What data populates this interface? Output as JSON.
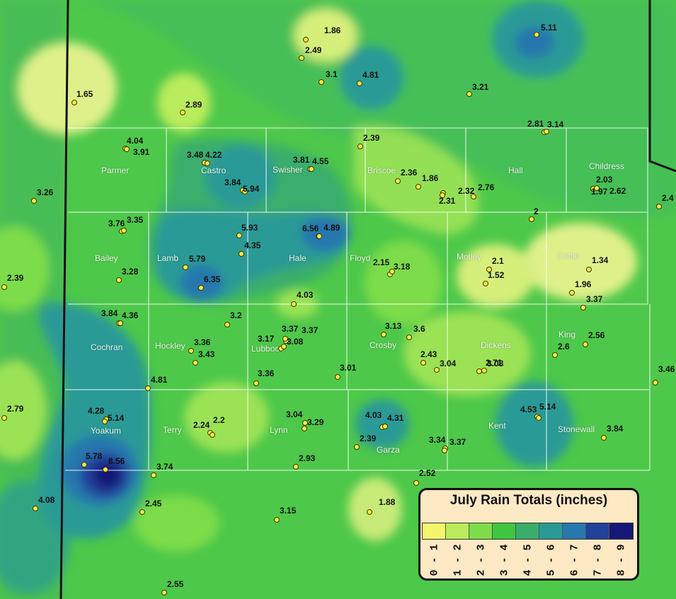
{
  "legend": {
    "title": "July Rain Totals (inches)",
    "bins": [
      {
        "label": "0 - 1",
        "color": "#f4f56c"
      },
      {
        "label": "1 - 2",
        "color": "#b9ec5c"
      },
      {
        "label": "2 - 3",
        "color": "#7ddc4a"
      },
      {
        "label": "3 - 4",
        "color": "#3fc63f"
      },
      {
        "label": "4 - 5",
        "color": "#3aad6c"
      },
      {
        "label": "5 - 6",
        "color": "#2a9a96"
      },
      {
        "label": "6 - 7",
        "color": "#2877ad"
      },
      {
        "label": "7 - 8",
        "color": "#22419a"
      },
      {
        "label": "8 - 9",
        "color": "#161877"
      }
    ]
  },
  "counties": [
    "Parmer",
    "Castro",
    "Swisher",
    "Briscoe",
    "Hall",
    "Childress",
    "Bailey",
    "Lamb",
    "Hale",
    "Floyd",
    "Motley",
    "Cottle",
    "Cochran",
    "Hockley",
    "Lubbock",
    "Crosby",
    "Dickens",
    "King",
    "Yoakum",
    "Terry",
    "Lynn",
    "Garza",
    "Kent",
    "Stonewall"
  ],
  "stations": [
    "1.86",
    "2.49",
    "5.11",
    "1.65",
    "3.1",
    "4.81",
    "3.21",
    "2.89",
    "2.81",
    "3.14",
    "4.04",
    "3.91",
    "2.39",
    "3.48",
    "4.22",
    "3.81",
    "4.55",
    "2.36",
    "1.86",
    "3.26",
    "3.84",
    "5.94",
    "2.32",
    "2.76",
    "2.31",
    "2.03",
    "1.97",
    "2.62",
    "2.4",
    "2",
    "3.76",
    "3.35",
    "5.93",
    "6.56",
    "4.89",
    "4.35",
    "2.39",
    "5.79",
    "2.15",
    "3.18",
    "2.1",
    "1.34",
    "3.28",
    "6.35",
    "1.52",
    "1.96",
    "4.03",
    "3.37",
    "3.84",
    "4.36",
    "3.2",
    "3.37",
    "3.37",
    "3.17",
    "3.13",
    "3.6",
    "3.36",
    "3.08",
    "2.56",
    "2.6",
    "3.43",
    "2.43",
    "3.04",
    "2.71",
    "3.08",
    "3.46",
    "3.01",
    "3.36",
    "4.81",
    "4.28",
    "5.14",
    "4.53",
    "5.14",
    "2.79",
    "2.24",
    "2.2",
    "3.04",
    "3.29",
    "4.03",
    "4.31",
    "3.84",
    "2.39",
    "3.34",
    "3.37",
    "5.78",
    "8.56",
    "2.93",
    "3.74",
    "2.52",
    "4.08",
    "2.45",
    "3.15",
    "1.88",
    "2.55"
  ]
}
